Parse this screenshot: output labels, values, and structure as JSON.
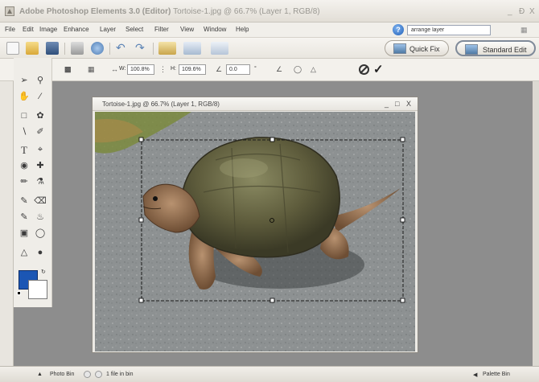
{
  "window": {
    "app_title": "Adobe Photoshop Elements 3.0 (Editor)",
    "doc_title": "Tortoise-1.jpg @ 66.7% (Layer 1, RGB/8)",
    "minimize": "_",
    "restore": "Ɖ",
    "close": "X"
  },
  "menu": {
    "items": [
      "File",
      "Edit",
      "Image",
      "Enhance",
      "Layer",
      "Select",
      "Filter",
      "View",
      "Window",
      "Help"
    ]
  },
  "search": {
    "value": "arrange layer"
  },
  "modes": {
    "quick_fix": "Quick Fix",
    "standard_edit": "Standard Edit"
  },
  "options": {
    "width_label": "W:",
    "width_value": "100.8%",
    "height_label": "H:",
    "height_value": "109.6%",
    "angle_value": "0.0",
    "degree": "°"
  },
  "document": {
    "title": "Tortoise-1.jpg @ 66.7% (Layer 1, RGB/8)",
    "minimize": "_",
    "maximize": "□",
    "close": "X"
  },
  "status": {
    "photo_bin": "Photo Bin",
    "file_count": "1 file in bin",
    "palette_bin": "Palette Bin"
  },
  "colors": {
    "foreground": "#1b56b4",
    "background": "#ffffff"
  }
}
